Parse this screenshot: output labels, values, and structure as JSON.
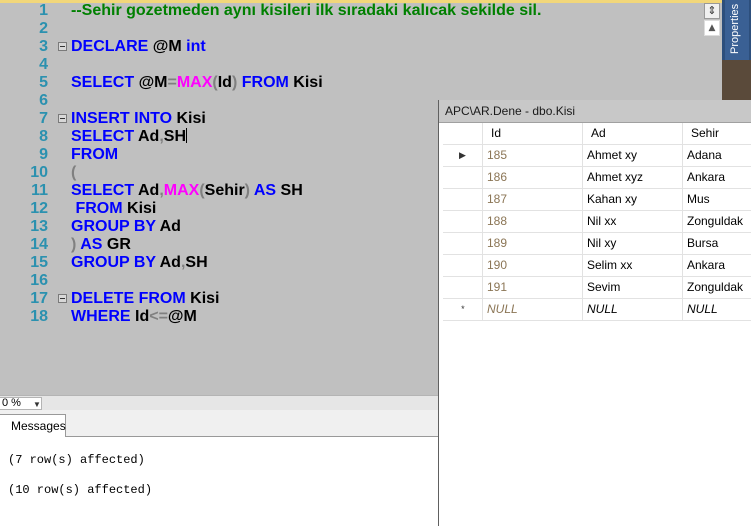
{
  "editor": {
    "lines": [
      {
        "n": "1",
        "fold": false,
        "parts": [
          {
            "t": "--Sehir gozetmeden aynı kisileri ilk sıradaki kalıcak sekilde sil.",
            "c": "cm"
          }
        ]
      },
      {
        "n": "2",
        "fold": false,
        "parts": []
      },
      {
        "n": "3",
        "fold": true,
        "parts": [
          {
            "t": "DECLARE",
            "c": "kw"
          },
          {
            "t": " @M ",
            "c": ""
          },
          {
            "t": "int",
            "c": "kw"
          }
        ]
      },
      {
        "n": "4",
        "fold": false,
        "parts": []
      },
      {
        "n": "5",
        "fold": false,
        "parts": [
          {
            "t": "SELECT",
            "c": "kw"
          },
          {
            "t": " @M",
            "c": ""
          },
          {
            "t": "=",
            "c": "op"
          },
          {
            "t": "MAX",
            "c": "fn"
          },
          {
            "t": "(",
            "c": "op"
          },
          {
            "t": "Id",
            "c": ""
          },
          {
            "t": ")",
            "c": "op"
          },
          {
            "t": " ",
            "c": ""
          },
          {
            "t": "FROM",
            "c": "kw"
          },
          {
            "t": " Kisi",
            "c": ""
          }
        ]
      },
      {
        "n": "6",
        "fold": false,
        "parts": []
      },
      {
        "n": "7",
        "fold": true,
        "parts": [
          {
            "t": "INSERT INTO",
            "c": "kw"
          },
          {
            "t": " Kisi",
            "c": ""
          }
        ]
      },
      {
        "n": "8",
        "fold": false,
        "caret": true,
        "parts": [
          {
            "t": "SELECT",
            "c": "kw"
          },
          {
            "t": " Ad",
            "c": ""
          },
          {
            "t": ",",
            "c": "op"
          },
          {
            "t": "SH",
            "c": ""
          }
        ]
      },
      {
        "n": "9",
        "fold": false,
        "parts": [
          {
            "t": "FROM",
            "c": "kw"
          }
        ]
      },
      {
        "n": "10",
        "fold": false,
        "parts": [
          {
            "t": "(",
            "c": "op"
          }
        ]
      },
      {
        "n": "11",
        "fold": false,
        "parts": [
          {
            "t": "SELECT",
            "c": "kw"
          },
          {
            "t": " Ad",
            "c": ""
          },
          {
            "t": ",",
            "c": "op"
          },
          {
            "t": "MAX",
            "c": "fn"
          },
          {
            "t": "(",
            "c": "op"
          },
          {
            "t": "Sehir",
            "c": ""
          },
          {
            "t": ")",
            "c": "op"
          },
          {
            "t": " ",
            "c": ""
          },
          {
            "t": "AS",
            "c": "kw"
          },
          {
            "t": " SH",
            "c": ""
          }
        ]
      },
      {
        "n": "12",
        "fold": false,
        "parts": [
          {
            "t": " ",
            "c": ""
          },
          {
            "t": "FROM",
            "c": "kw"
          },
          {
            "t": " Kisi",
            "c": ""
          }
        ]
      },
      {
        "n": "13",
        "fold": false,
        "parts": [
          {
            "t": "GROUP BY",
            "c": "kw"
          },
          {
            "t": " Ad",
            "c": ""
          }
        ]
      },
      {
        "n": "14",
        "fold": false,
        "parts": [
          {
            "t": ")",
            "c": "op"
          },
          {
            "t": " ",
            "c": ""
          },
          {
            "t": "AS",
            "c": "kw"
          },
          {
            "t": " GR",
            "c": ""
          }
        ]
      },
      {
        "n": "15",
        "fold": false,
        "parts": [
          {
            "t": "GROUP BY",
            "c": "kw"
          },
          {
            "t": " Ad",
            "c": ""
          },
          {
            "t": ",",
            "c": "op"
          },
          {
            "t": "SH",
            "c": ""
          }
        ]
      },
      {
        "n": "16",
        "fold": false,
        "parts": []
      },
      {
        "n": "17",
        "fold": true,
        "parts": [
          {
            "t": "DELETE",
            "c": "kw"
          },
          {
            "t": " ",
            "c": ""
          },
          {
            "t": "FROM",
            "c": "kw"
          },
          {
            "t": " Kisi",
            "c": ""
          }
        ]
      },
      {
        "n": "18",
        "fold": false,
        "parts": [
          {
            "t": "WHERE",
            "c": "kw"
          },
          {
            "t": " Id",
            "c": ""
          },
          {
            "t": "<=",
            "c": "op"
          },
          {
            "t": "@M",
            "c": ""
          }
        ]
      }
    ],
    "scroll_thumb_glyph": "⇕",
    "scroll_up_glyph": "▲"
  },
  "right_panel": {
    "properties_label": "Properties"
  },
  "zoom": {
    "value": "0 %",
    "arrow": "▼"
  },
  "results": {
    "tab_label": "Messages",
    "messages": [
      "(7 row(s) affected)",
      "(10 row(s) affected)"
    ]
  },
  "table_window": {
    "title": "APC\\AR.Dene - dbo.Kisi",
    "columns": [
      "Id",
      "Ad",
      "Sehir"
    ],
    "current_row_marker": "▶",
    "new_row_marker": "*",
    "rows": [
      [
        "185",
        "Ahmet xy",
        "Adana"
      ],
      [
        "186",
        "Ahmet xyz",
        "Ankara"
      ],
      [
        "187",
        "Kahan xy",
        "Mus"
      ],
      [
        "188",
        "Nil xx",
        "Zonguldak"
      ],
      [
        "189",
        "Nil xy",
        "Bursa"
      ],
      [
        "190",
        "Selim xx",
        "Ankara"
      ],
      [
        "191",
        "Sevim",
        "Zonguldak"
      ]
    ],
    "null_row": [
      "NULL",
      "NULL",
      "NULL"
    ]
  },
  "colors": {
    "keyword": "#0000ff",
    "function": "#ff00ff",
    "comment": "#008000",
    "line_number": "#2b91af",
    "editor_background": "#c0c0c0"
  }
}
